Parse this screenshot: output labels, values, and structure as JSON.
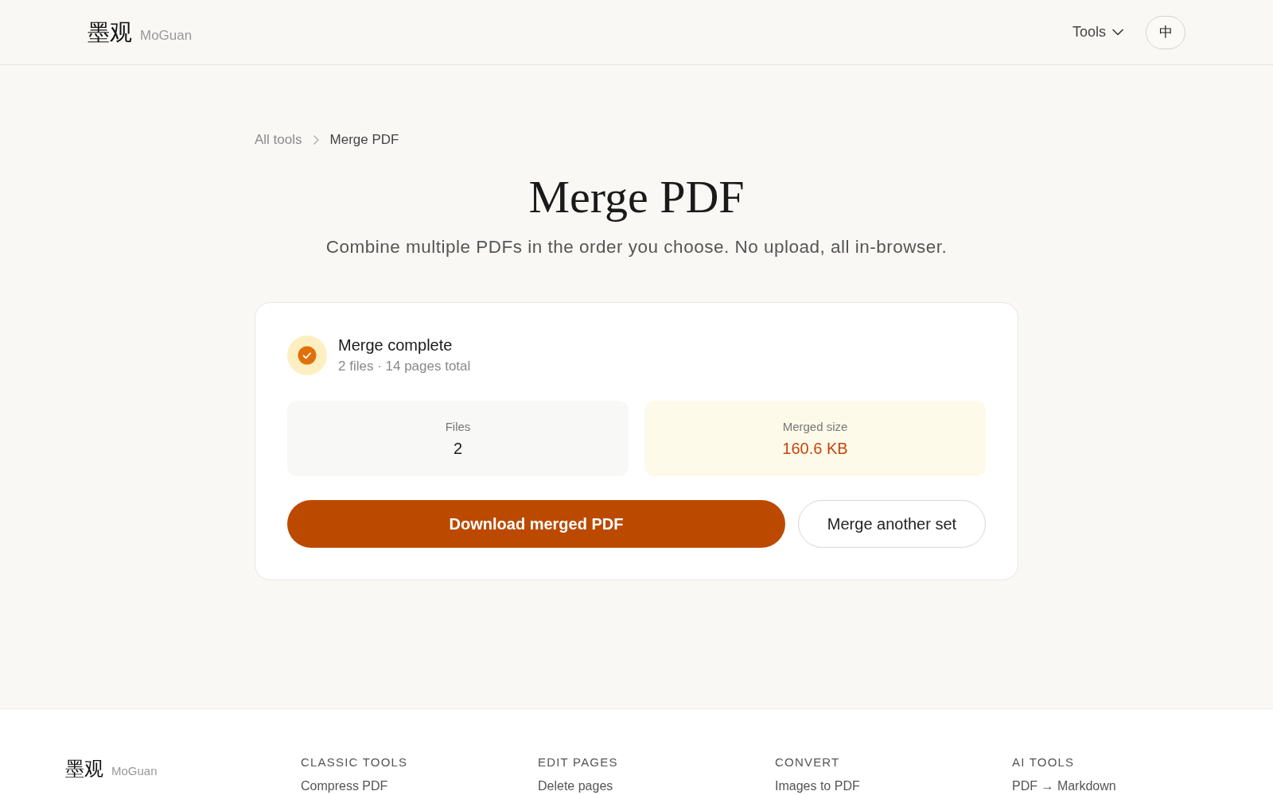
{
  "header": {
    "logo_mark": "墨观",
    "logo_name": "MoGuan",
    "menu_label": "Tools",
    "language_button": "中"
  },
  "breadcrumb": [
    {
      "label": "All tools",
      "current": false
    },
    {
      "label": "Merge PDF",
      "current": true
    }
  ],
  "title": "Merge PDF",
  "subtitle": "Combine multiple PDFs in the order you choose. No upload, all in-browser.",
  "result": {
    "status": {
      "title": "Merge complete",
      "detail": "2 files · 14 pages total"
    },
    "stats": [
      {
        "label": "Files",
        "value": "2",
        "highlighted": false
      },
      {
        "label": "Merged size",
        "value": "160.6 KB",
        "highlighted": true
      }
    ],
    "actions": [
      {
        "label": "Download merged PDF",
        "kind": "primary"
      },
      {
        "label": "Merge another set",
        "kind": "secondary"
      }
    ]
  },
  "footer": {
    "logo_mark": "墨观",
    "logo_name": "MoGuan",
    "columns": [
      {
        "heading": "CLASSIC TOOLS",
        "links": [
          "Compress PDF"
        ]
      },
      {
        "heading": "EDIT PAGES",
        "links": [
          "Delete pages"
        ]
      },
      {
        "heading": "CONVERT",
        "links": [
          "Images to PDF"
        ]
      },
      {
        "heading": "AI TOOLS",
        "links": [
          "PDF → Markdown"
        ]
      }
    ]
  }
}
